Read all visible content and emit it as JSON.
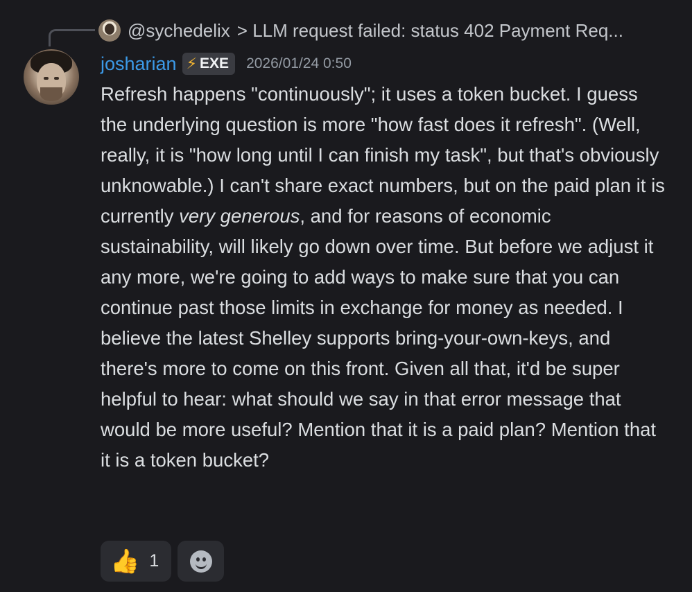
{
  "reply": {
    "author": "@sychedelix",
    "preview": "> LLM request failed: status 402 Payment Req..."
  },
  "author": {
    "name": "josharian",
    "tag_icon": "lightning-bolt-icon",
    "tag_label": "EXE",
    "timestamp": "2026/01/24 0:50"
  },
  "message": {
    "text_before_em": "Refresh happens \"continuously\"; it uses a token bucket. I guess the underlying question is more \"how fast does it refresh\". (Well, really, it is \"how long until I can finish my task\", but that's obviously unknowable.) I can't share exact numbers, but on the paid plan it is currently ",
    "emphasis": "very generous",
    "text_after_em": ", and for reasons of economic sustainability, will likely go down over time. But before we adjust it any more, we're going to add ways to make sure that you can continue past those limits in exchange for money as needed. I believe the latest Shelley supports bring-your-own-keys, and there's more to come on this front. Given all that, it'd be super helpful to hear: what should we say in that error message that would be more useful? Mention that it is a paid plan? Mention that it is a token bucket?"
  },
  "reactions": [
    {
      "icon": "thumbs-up-icon",
      "emoji": "👍",
      "count": "1"
    }
  ],
  "add_reaction_icon": "add-reaction-icon",
  "colors": {
    "background": "#1a1a1e",
    "username": "#3c9ae8",
    "tag_bolt": "#f0b232",
    "timestamp": "#949ba4",
    "body_text": "#dbdee1"
  }
}
